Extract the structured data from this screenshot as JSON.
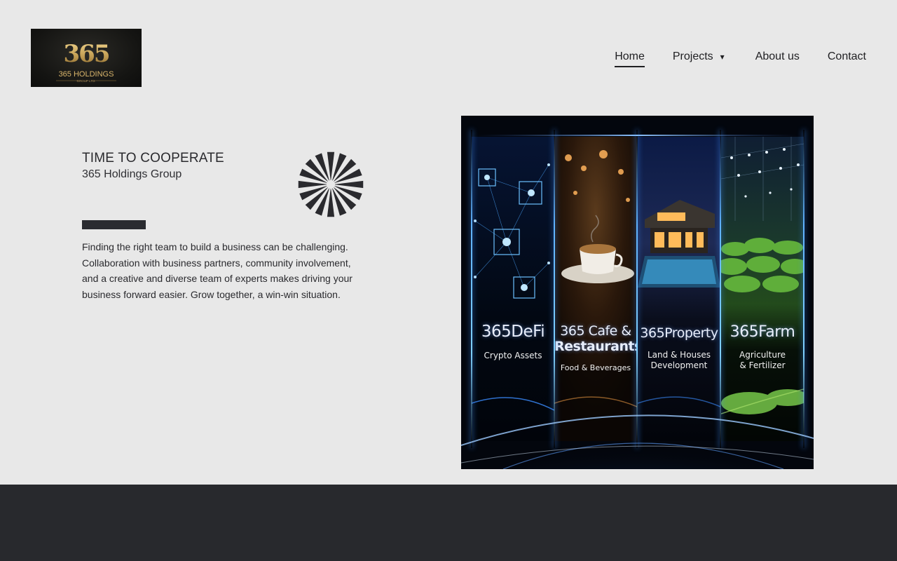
{
  "logo": {
    "number": "365",
    "name": "365 HOLDINGS",
    "sub": "GROUP LTD."
  },
  "nav": {
    "home": "Home",
    "projects": "Projects",
    "projects_caret": "▾",
    "about": "About us",
    "contact": "Contact"
  },
  "hero_text": {
    "tagline": "TIME TO COOPERATE",
    "subtitle": "365 Holdings Group",
    "description": "Finding the right team to build a business can be challenging. Collaboration with business partners, community involvement, and a creative and diverse team of experts makes driving your business forward easier. Grow together, a win-win situation."
  },
  "hero_image": {
    "panels": [
      {
        "title": "365DeFi",
        "subtitle": "Crypto Assets"
      },
      {
        "title_line1": "365 Cafe &",
        "title_line2": "Restaurants",
        "subtitle": "Food & Beverages"
      },
      {
        "title": "365Property",
        "subtitle_line1": "Land & Houses",
        "subtitle_line2": "Development"
      },
      {
        "title": "365Farm",
        "subtitle_line1": "Agriculture",
        "subtitle_line2": "& Fertilizer"
      }
    ]
  },
  "colors": {
    "background": "#e8e8e8",
    "footer": "#28292d",
    "accent_bar": "#2a2b30",
    "logo_gold": "#c9a55a",
    "hero_glow": "#5fb2ff"
  }
}
